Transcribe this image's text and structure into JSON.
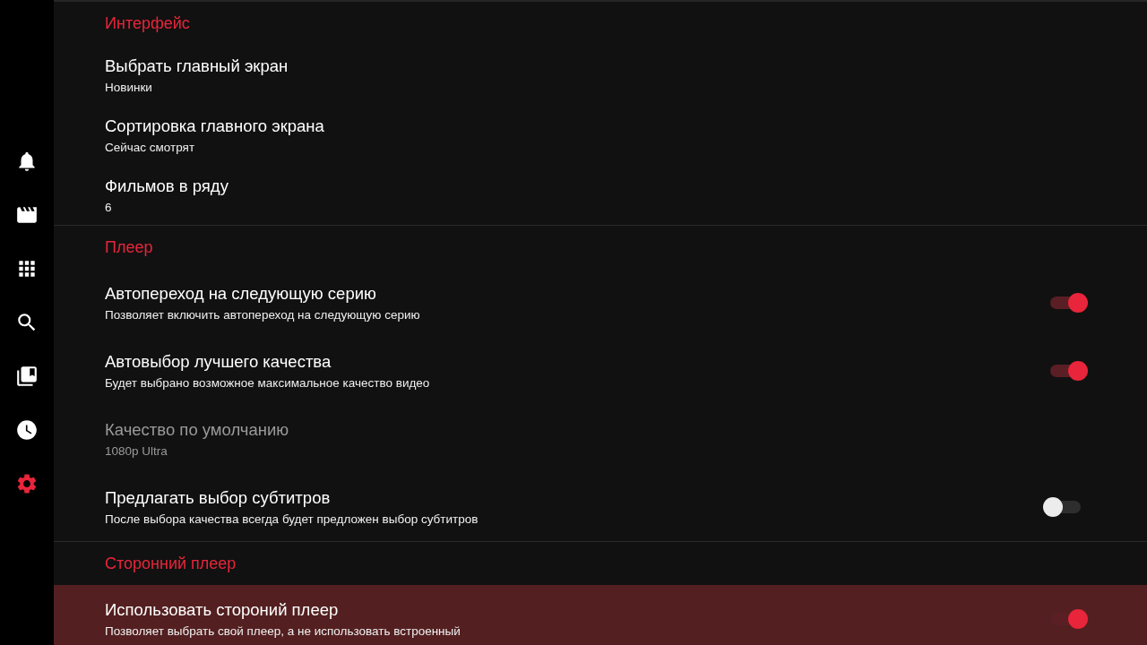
{
  "sidebar": {
    "items": [
      {
        "kind": "notifications",
        "selected": false
      },
      {
        "kind": "movies",
        "selected": false
      },
      {
        "kind": "categories",
        "selected": false
      },
      {
        "kind": "search",
        "selected": false
      },
      {
        "kind": "bookmarks",
        "selected": false
      },
      {
        "kind": "history",
        "selected": false
      },
      {
        "kind": "settings",
        "selected": true
      }
    ]
  },
  "sections": [
    {
      "title": "Интерфейс",
      "items": [
        {
          "kind": "value",
          "title": "Выбрать главный экран",
          "subtitle": "Новинки",
          "disabled": false,
          "focused": false
        },
        {
          "kind": "value",
          "title": "Сортировка главного экрана",
          "subtitle": "Сейчас смотрят",
          "disabled": false,
          "focused": false
        },
        {
          "kind": "value",
          "title": "Фильмов в ряду",
          "subtitle": "6",
          "disabled": false,
          "focused": false
        }
      ]
    },
    {
      "title": "Плеер",
      "items": [
        {
          "kind": "toggle",
          "title": "Автопереход на следующую серию",
          "subtitle": "Позволяет включить автопереход на следующую серию",
          "on": true,
          "disabled": false,
          "focused": false
        },
        {
          "kind": "toggle",
          "title": "Автовыбор лучшего качества",
          "subtitle": "Будет выбрано возможное максимальное качество видео",
          "on": true,
          "disabled": false,
          "focused": false
        },
        {
          "kind": "value",
          "title": "Качество по умолчанию",
          "subtitle": "1080p Ultra",
          "disabled": true,
          "focused": false
        },
        {
          "kind": "toggle",
          "title": "Предлагать выбор субтитров",
          "subtitle": "После выбора качества всегда будет предложен выбор субтитров",
          "on": false,
          "disabled": false,
          "focused": false
        }
      ]
    },
    {
      "title": "Сторонний плеер",
      "items": [
        {
          "kind": "toggle",
          "title": "Использовать стороний плеер",
          "subtitle": "Позволяет выбрать свой плеер, а не использовать встроенный",
          "on": true,
          "disabled": false,
          "focused": true
        }
      ]
    }
  ]
}
